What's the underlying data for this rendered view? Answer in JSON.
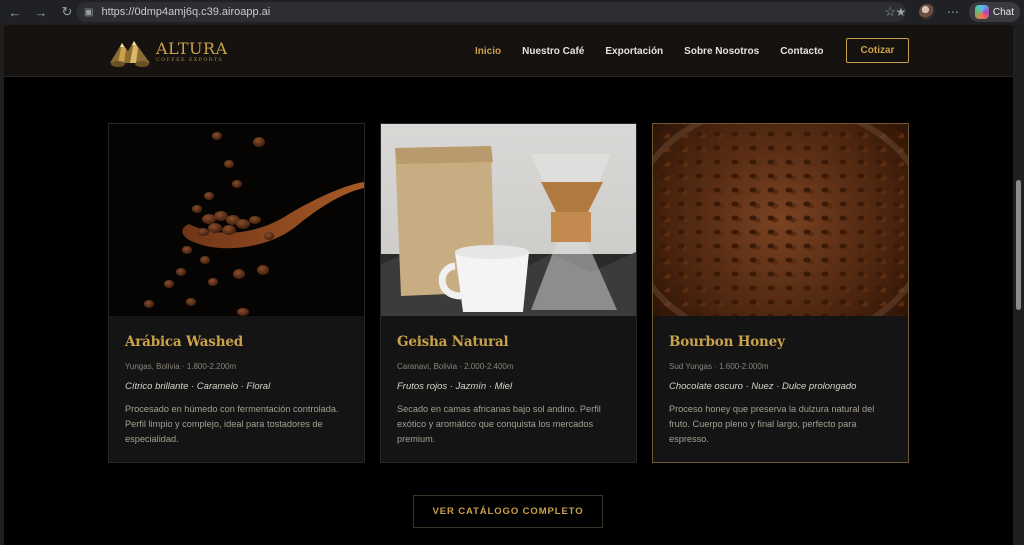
{
  "browser": {
    "url": "https://0dmp4amj6q.c39.airoapp.ai",
    "chat_label": "Chat"
  },
  "site": {
    "brand": "ALTURA",
    "brand_sub": "COFFEE EXPORTS",
    "nav": [
      {
        "label": "Inicio",
        "active": true
      },
      {
        "label": "Nuestro Café",
        "active": false
      },
      {
        "label": "Exportación",
        "active": false
      },
      {
        "label": "Sobre Nosotros",
        "active": false
      },
      {
        "label": "Contacto",
        "active": false
      }
    ],
    "cta_label": "Cotizar"
  },
  "products": [
    {
      "name": "Arábica Washed",
      "meta": "Yungas, Bolivia · 1.800-2.200m",
      "notes": "Cítrico brillante · Caramelo · Floral",
      "description": "Procesado en húmedo con fermentación controlada. Perfil limpio y complejo, ideal para tostadores de especialidad.",
      "image": "coffee-beans-spoon"
    },
    {
      "name": "Geisha Natural",
      "meta": "Caranavi, Bolivia · 2.000-2.400m",
      "notes": "Frutos rojos · Jazmín · Miel",
      "description": "Secado en camas africanas bajo sol andino. Perfil exótico y aromático que conquista los mercados premium.",
      "image": "coffee-bag-chemex"
    },
    {
      "name": "Bourbon Honey",
      "meta": "Sud Yungas · 1.600-2.000m",
      "notes": "Chocolate oscuro · Nuez · Dulce prolongado",
      "description": "Proceso honey que preserva la dulzura natural del fruto. Cuerpo pleno y final largo, perfecto para espresso.",
      "image": "roasted-beans-bowl"
    }
  ],
  "catalog_button": "VER CATÁLOGO COMPLETO",
  "colors": {
    "accent": "#c9a14a",
    "background": "#000000",
    "card": "#141414"
  }
}
